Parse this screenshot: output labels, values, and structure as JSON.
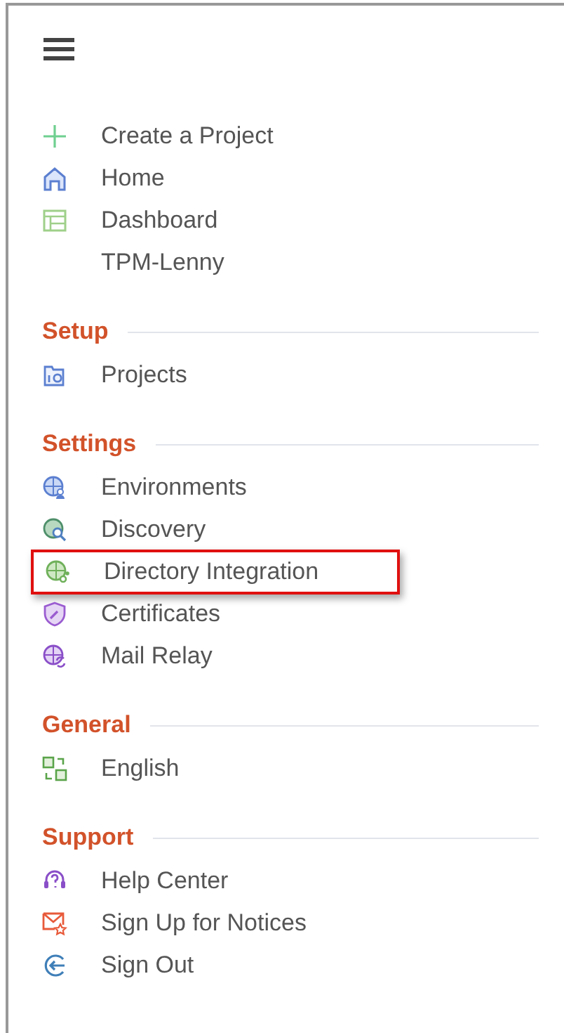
{
  "top_items": [
    {
      "label": "Create a Project",
      "kind": "plus",
      "highlighted": false
    },
    {
      "label": "Home",
      "kind": "house",
      "highlighted": false
    },
    {
      "label": "Dashboard",
      "kind": "panel",
      "highlighted": false
    },
    {
      "label": "TPM-Lenny",
      "kind": "none",
      "highlighted": false
    }
  ],
  "sections": [
    {
      "title": "Setup",
      "items": [
        {
          "label": "Projects",
          "kind": "folder",
          "highlighted": false
        }
      ]
    },
    {
      "title": "Settings",
      "items": [
        {
          "label": "Environments",
          "kind": "globeuser",
          "highlighted": false
        },
        {
          "label": "Discovery",
          "kind": "globesearch",
          "highlighted": false
        },
        {
          "label": "Directory Integration",
          "kind": "globenet",
          "highlighted": true
        },
        {
          "label": "Certificates",
          "kind": "shield",
          "highlighted": false
        },
        {
          "label": "Mail Relay",
          "kind": "globesync",
          "highlighted": false
        }
      ]
    },
    {
      "title": "General",
      "items": [
        {
          "label": "English",
          "kind": "translate",
          "highlighted": false
        }
      ]
    },
    {
      "title": "Support",
      "items": [
        {
          "label": "Help Center",
          "kind": "headset",
          "highlighted": false
        },
        {
          "label": "Sign Up for Notices",
          "kind": "mailstar",
          "highlighted": false
        },
        {
          "label": "Sign Out",
          "kind": "signout",
          "highlighted": false
        }
      ]
    }
  ]
}
